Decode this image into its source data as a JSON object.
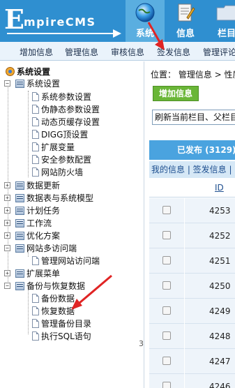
{
  "header": {
    "logo_big": "E",
    "logo_small": "mpireCMS",
    "tabs": [
      {
        "label": "系统",
        "icon": "globe-icon"
      },
      {
        "label": "信息",
        "icon": "document-icon"
      },
      {
        "label": "栏目",
        "icon": "folder-icon"
      }
    ]
  },
  "subnav": [
    "增加信息",
    "管理信息",
    "审核信息",
    "签发信息",
    "管理评论"
  ],
  "tree": {
    "root": "系统设置",
    "system_settings": {
      "label": "系统设置",
      "children": [
        "系统参数设置",
        "伪静态参数设置",
        "动态页缓存设置",
        "DIGG顶设置",
        "扩展变量",
        "安全参数配置",
        "网站防火墙"
      ]
    },
    "data_update": "数据更新",
    "data_tables": "数据表与系统模型",
    "scheduled_tasks": "计划任务",
    "workflow": "工作流",
    "optimization": "优化方案",
    "multi_access": {
      "label": "网站多访问端",
      "children": [
        "管理网站访问端"
      ]
    },
    "ext_menu": "扩展菜单",
    "backup": {
      "label": "备份与恢复数据",
      "children": [
        "备份数据",
        "恢复数据",
        "管理备份目录",
        "执行SQL语句"
      ]
    }
  },
  "right": {
    "breadcrumb_label": "位置：",
    "breadcrumb_path": "管理信息 > 性质",
    "add_button": "增加信息",
    "refresh_select": "刷新当前栏目、父栏目",
    "published": "已发布 (3129)",
    "subtabs": "我的信息 | 签发信息 |",
    "id_header": "ID",
    "rows": [
      "4253",
      "4252",
      "4251",
      "4250",
      "4249",
      "4248",
      "4247",
      "4246"
    ],
    "stray_char": "3"
  },
  "colors": {
    "header_bg": "#2f8fd0",
    "active_tab_bg": "#5aaee0",
    "add_button_bg": "#6ab637",
    "annotation_arrow": "#e02424"
  }
}
